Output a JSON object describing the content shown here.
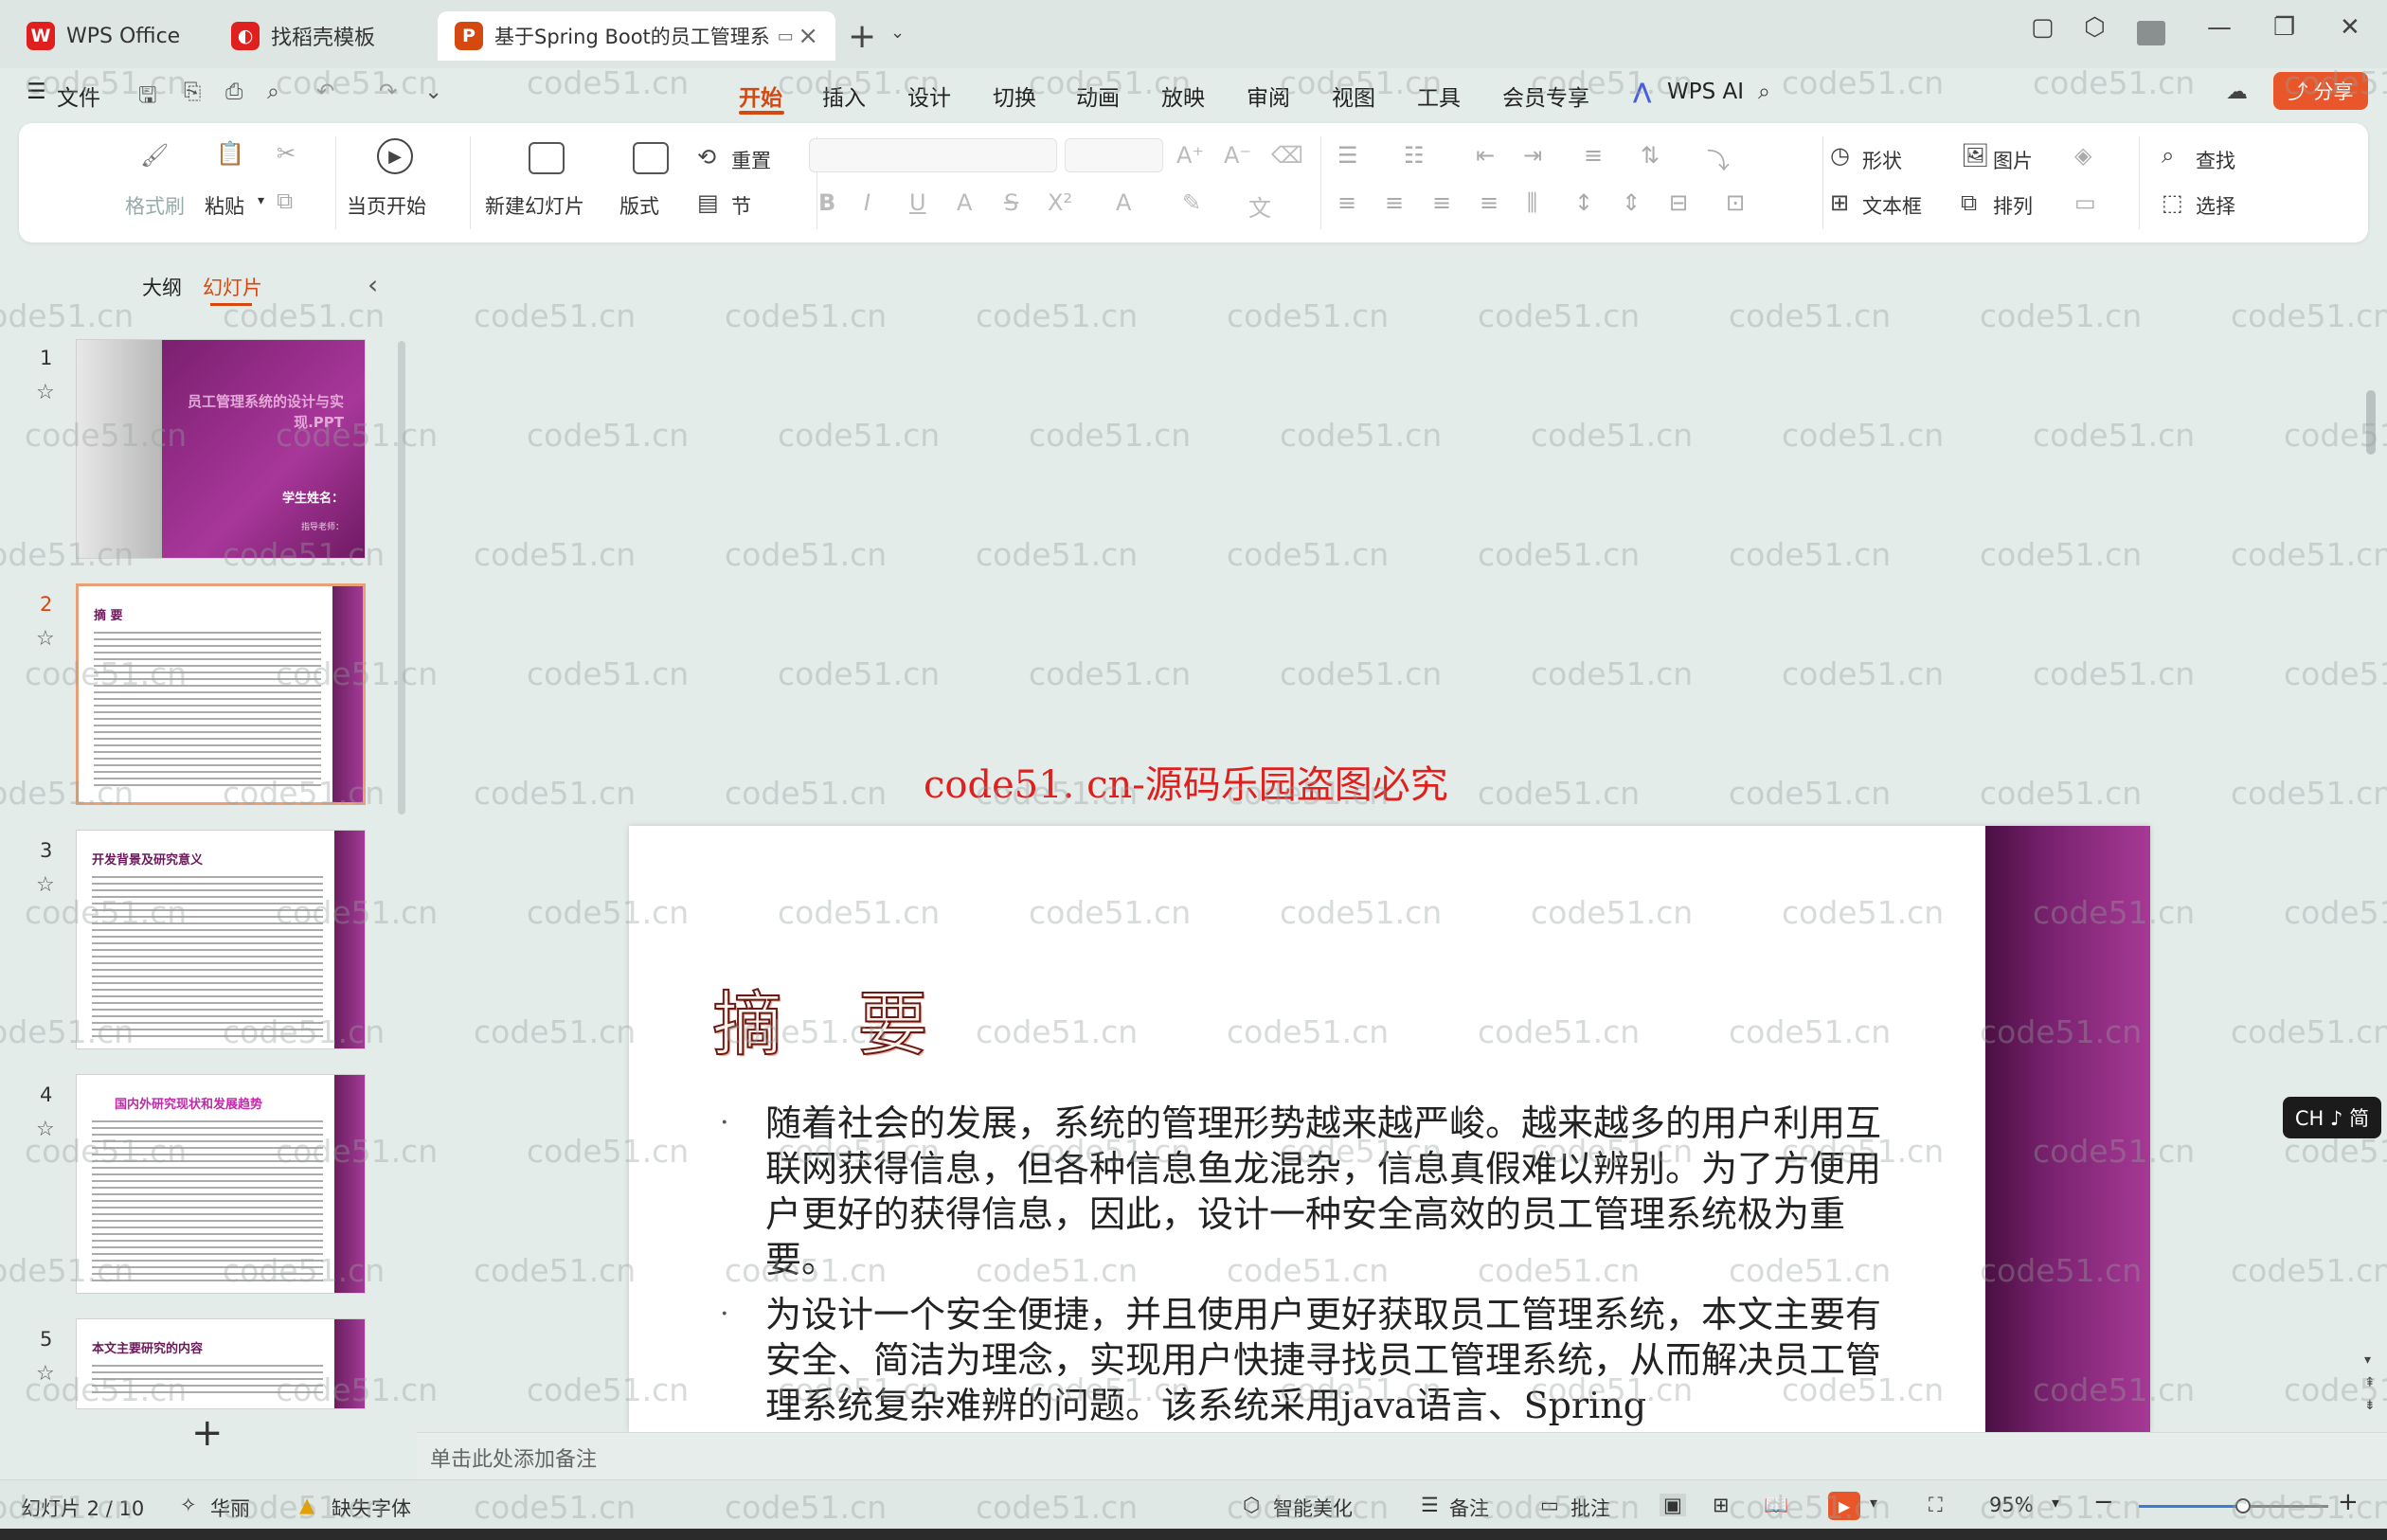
{
  "tabs": [
    {
      "label": "WPS Office",
      "icon": "wps-logo-icon",
      "color": "#e0201e"
    },
    {
      "label": "找稻壳模板",
      "icon": "docer-icon",
      "color": "#e0201e"
    },
    {
      "label": "基于Spring Boot的员工管理系",
      "icon": "presentation-icon",
      "color": "#d5480f"
    }
  ],
  "menu": {
    "file": "文件",
    "items": [
      "开始",
      "插入",
      "设计",
      "切换",
      "动画",
      "放映",
      "审阅",
      "视图",
      "工具",
      "会员专享"
    ],
    "wps_ai": "WPS AI",
    "share": "分享"
  },
  "ribbon": {
    "format_painter": "格式刷",
    "paste": "粘贴",
    "play_from_current": "当页开始",
    "new_slide": "新建幻灯片",
    "layout": "版式",
    "reset": "重置",
    "section": "节",
    "shape": "形状",
    "picture": "图片",
    "find": "查找",
    "textbox": "文本框",
    "arrange": "排列",
    "select": "选择"
  },
  "left_panel": {
    "tab_outline": "大纲",
    "tab_slides": "幻灯片",
    "thumbnails": [
      {
        "num": "1",
        "title": "员工管理系统的设计与实现.PPT",
        "name": "学生姓名：",
        "sub": "指导老师："
      },
      {
        "num": "2",
        "title": "摘  要"
      },
      {
        "num": "3",
        "title": "开发背景及研究意义"
      },
      {
        "num": "4",
        "title": "国内外研究现状和发展趋势"
      },
      {
        "num": "5",
        "title": "本文主要研究的内容"
      }
    ]
  },
  "watermark": {
    "text": "code51.cn",
    "red": "code51. cn-源码乐园盗图必究"
  },
  "slide": {
    "title": "摘  要",
    "bullets": [
      "随着社会的发展，系统的管理形势越来越严峻。越来越多的用户利用互联网获得信息，但各种信息鱼龙混杂，信息真假难以辨别。为了方便用户更好的获得信息，因此，设计一种安全高效的员工管理系统极为重要。",
      "为设计一个安全便捷，并且使用户更好获取员工管理系统，本文主要有安全、简洁为理念，实现用户快捷寻找员工管理系统，从而解决员工管理系统复杂难辨的问题。该系统采用java语言、Spring"
    ]
  },
  "notes_placeholder": "单击此处添加备注",
  "ime_badge": "CH ♪ 简",
  "status": {
    "slide_counter": "幻灯片 2 / 10",
    "theme": "华丽",
    "missing_font": "缺失字体",
    "smart_beautify": "智能美化",
    "notes": "备注",
    "comments": "批注",
    "zoom": "95%",
    "zoom_level": 0.55
  }
}
